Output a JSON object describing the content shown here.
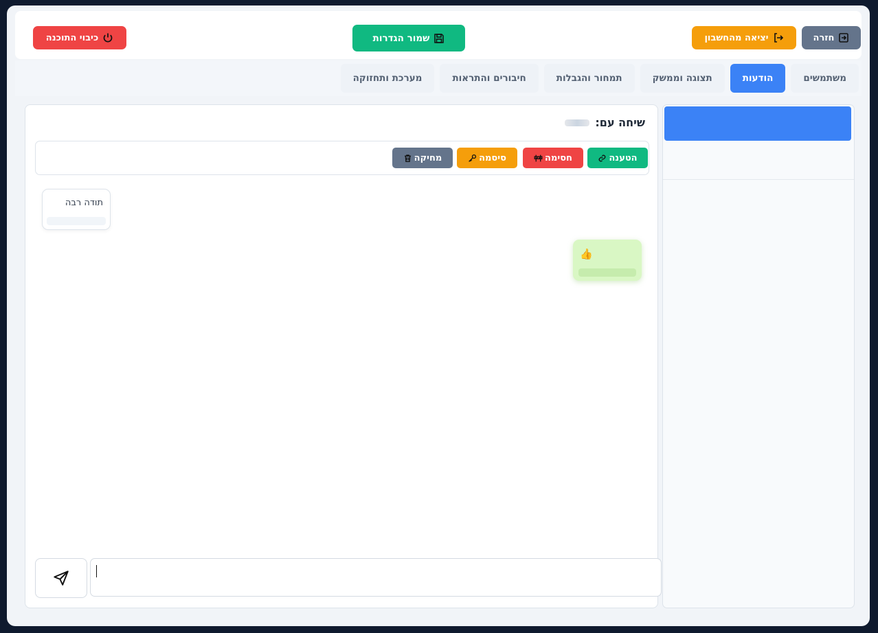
{
  "header": {
    "back_label": "חזרה",
    "logout_label": "יציאה מהחשבון",
    "save_label": "שמור הגדרות",
    "shutdown_label": "כיבוי התוכנה"
  },
  "tabs": [
    {
      "label": "משתמשים",
      "active": false
    },
    {
      "label": "הודעות",
      "active": true
    },
    {
      "label": "תצוגה וממשק",
      "active": false
    },
    {
      "label": "תמחור והגבלות",
      "active": false
    },
    {
      "label": "חיבורים והתראות",
      "active": false
    },
    {
      "label": "מערכת ותחזוקה",
      "active": false
    }
  ],
  "chat": {
    "title": "שיחה עם:",
    "actions": {
      "load": "הטענה",
      "block": "חסימה",
      "password": "סיסמה",
      "delete": "מחיקה"
    },
    "messages": [
      {
        "direction": "incoming",
        "text": "תודה רבה"
      },
      {
        "direction": "outgoing",
        "text": "👍"
      }
    ],
    "input_value": ""
  },
  "colors": {
    "primary": "#3b82f6",
    "success": "#10b981",
    "warning": "#f59e0b",
    "danger": "#ef4444",
    "neutral": "#64748b"
  }
}
